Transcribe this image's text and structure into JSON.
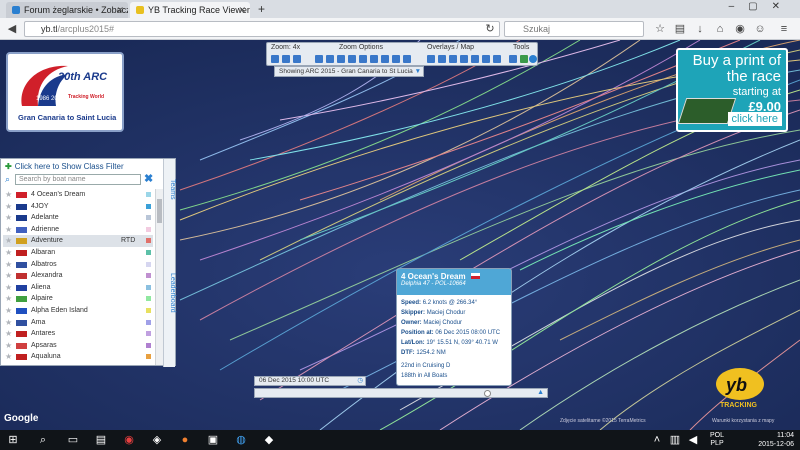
{
  "browser": {
    "tabs": [
      {
        "label": "Forum żeglarskie • Zobacz...",
        "active": false
      },
      {
        "label": "YB Tracking Race Viewer -...",
        "active": true
      }
    ],
    "new_tab": "+",
    "url_domain": "yb.tl",
    "url_path": "/arcplus2015#",
    "search_placeholder": "Szukaj"
  },
  "logo": {
    "title": "30th ARC",
    "years": "1986 2015",
    "sponsor": "Tracking World",
    "route": "Gran Canaria to Saint Lucia"
  },
  "toolbar": {
    "zoom": "Zoom: 4x",
    "zoom_options": "Zoom Options",
    "overlays": "Overlays / Map",
    "tools": "Tools",
    "showing": "Showing ARC 2015 - Gran Canaria to St Lucia"
  },
  "print_ad": {
    "line1": "Buy a print of",
    "line2": "the race",
    "starting": "starting at",
    "price": "£9.00",
    "cta": "click here"
  },
  "panel": {
    "filter_label": "Click here to Show Class Filter",
    "search_placeholder": "Search by boat name",
    "tab_teams": "Teams",
    "tab_leaderboard": "Leaderboard",
    "boats": [
      {
        "name": "4 Ocean's Dream",
        "status": "",
        "color": "#9bd6e8"
      },
      {
        "name": "4JOY",
        "status": "",
        "color": "#3aa0d8"
      },
      {
        "name": "Adelante",
        "status": "",
        "color": "#b9c6d8"
      },
      {
        "name": "Adrienne",
        "status": "",
        "color": "#f2cbe0"
      },
      {
        "name": "Adventure",
        "status": "RTD",
        "color": "#e0706a"
      },
      {
        "name": "Albaran",
        "status": "",
        "color": "#5cc0a8"
      },
      {
        "name": "Albatros",
        "status": "",
        "color": "#d6d6f0"
      },
      {
        "name": "Alexandra",
        "status": "",
        "color": "#c090d0"
      },
      {
        "name": "Aliena",
        "status": "",
        "color": "#8bc0e0"
      },
      {
        "name": "Alpaire",
        "status": "",
        "color": "#90e8a0"
      },
      {
        "name": "Alpha Eden Island",
        "status": "",
        "color": "#e8e060"
      },
      {
        "name": "Ama",
        "status": "",
        "color": "#a0a0e8"
      },
      {
        "name": "Antares",
        "status": "",
        "color": "#c0a0e0"
      },
      {
        "name": "Apsaras",
        "status": "",
        "color": "#b080d0"
      },
      {
        "name": "Aqualuna",
        "status": "",
        "color": "#e8a040"
      }
    ]
  },
  "popup": {
    "boat": "4 Ocean's Dream",
    "model": "Delphia 47 - POL-10664",
    "speed_label": "Speed:",
    "speed": "6.2 knots @ 266.34°",
    "skipper_label": "Skipper:",
    "skipper": "Maciej Chodur",
    "owner_label": "Owner:",
    "owner": "Maciej Chodur",
    "position_label": "Position at:",
    "position": "06 Dec 2015 08:00 UTC",
    "latlon_label": "Lat/Lon:",
    "latlon": "19° 15.51 N, 039° 40.71 W",
    "dtf_label": "DTF:",
    "dtf": "1254.2 NM",
    "rank_class": "22nd in Cruising D",
    "rank_all": "188th in All Boats"
  },
  "timeline": {
    "time": "06 Dec 2015 10:00 UTC",
    "progress": 0.9
  },
  "map": {
    "attribution": "Zdjęcie satelitarne ©2015 TerraMetrics",
    "attribution2": "Warunki korzystania z mapy",
    "google": "Google"
  },
  "brand": {
    "yb": "TRACKING"
  },
  "taskbar": {
    "lang_top": "POL",
    "lang_bottom": "PLP",
    "time": "11:04",
    "date": "2015-12-06"
  },
  "colors": {
    "map_bg": "#23366a",
    "popup_header": "#4fa7d6",
    "print_ad": "#1ea4b8"
  }
}
